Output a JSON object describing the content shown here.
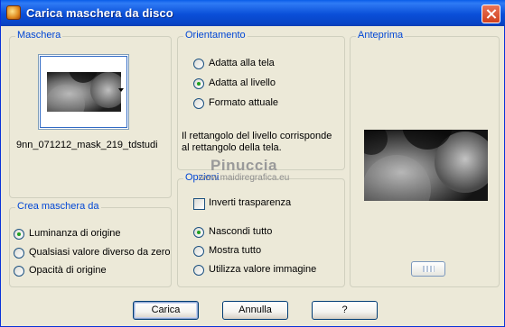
{
  "window": {
    "title": "Carica maschera da disco"
  },
  "maschera": {
    "legend": "Maschera",
    "filename": "9nn_071212_mask_219_tdstudi"
  },
  "orientamento": {
    "legend": "Orientamento",
    "options": [
      {
        "label": "Adatta alla tela",
        "checked": false
      },
      {
        "label": "Adatta al livello",
        "checked": true
      },
      {
        "label": "Formato attuale",
        "checked": false
      }
    ],
    "description": "Il rettangolo del livello corrisponde al rettangolo della tela."
  },
  "anteprima": {
    "legend": "Anteprima"
  },
  "crea": {
    "legend": "Crea maschera da",
    "options": [
      {
        "label": "Luminanza di origine",
        "checked": true
      },
      {
        "label": "Qualsiasi valore diverso da zero",
        "checked": false
      },
      {
        "label": "Opacità di origine",
        "checked": false
      }
    ]
  },
  "opzioni": {
    "legend": "Opzioni",
    "invert_label": "Inverti trasparenza",
    "invert_checked": false,
    "options": [
      {
        "label": "Nascondi tutto",
        "checked": true
      },
      {
        "label": "Mostra tutto",
        "checked": false
      },
      {
        "label": "Utilizza valore immagine",
        "checked": false
      }
    ]
  },
  "watermark": {
    "line1": "Pinuccia",
    "line2": "www.maidiregrafica.eu"
  },
  "buttons": {
    "carica": "Carica",
    "annulla": "Annulla",
    "help": "?"
  }
}
